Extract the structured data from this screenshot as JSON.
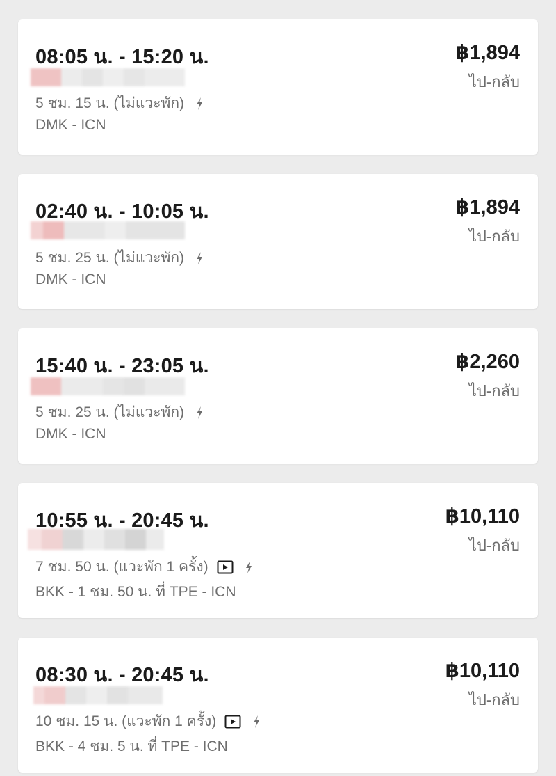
{
  "flights": [
    {
      "time": "08:05 น. - 15:20 น.",
      "price": "฿1,894",
      "trip_type": "ไป-กลับ",
      "duration": "5 ชม. 15 น. (ไม่แวะพัก)",
      "route": "DMK - ICN",
      "icons": [
        "bolt-icon"
      ]
    },
    {
      "time": "02:40 น. - 10:05 น.",
      "price": "฿1,894",
      "trip_type": "ไป-กลับ",
      "duration": "5 ชม. 25 น. (ไม่แวะพัก)",
      "route": "DMK - ICN",
      "icons": [
        "bolt-icon"
      ]
    },
    {
      "time": "15:40 น. - 23:05 น.",
      "price": "฿2,260",
      "trip_type": "ไป-กลับ",
      "duration": "5 ชม. 25 น. (ไม่แวะพัก)",
      "route": "DMK - ICN",
      "icons": [
        "bolt-icon"
      ]
    },
    {
      "time": "10:55 น. - 20:45 น.",
      "price": "฿10,110",
      "trip_type": "ไป-กลับ",
      "duration": "7 ชม. 50 น. (แวะพัก 1 ครั้ง)",
      "route": "BKK - 1 ชม. 50 น. ที่ TPE - ICN",
      "icons": [
        "play-media-icon",
        "bolt-icon"
      ]
    },
    {
      "time": "08:30 น. - 20:45 น.",
      "price": "฿10,110",
      "trip_type": "ไป-กลับ",
      "duration": "10 ชม. 15 น. (แวะพัก 1 ครั้ง)",
      "route": "BKK - 4 ชม. 5 น. ที่ TPE - ICN",
      "icons": [
        "play-media-icon",
        "bolt-icon"
      ]
    }
  ],
  "colors": {
    "background": "#ececec",
    "card": "#ffffff",
    "primary_text": "#1b1b1b",
    "secondary_text": "#6e6e6e",
    "airline_blur_accent": "#f0c4c4",
    "airline_blur_neutral": "#e6e6e6"
  }
}
